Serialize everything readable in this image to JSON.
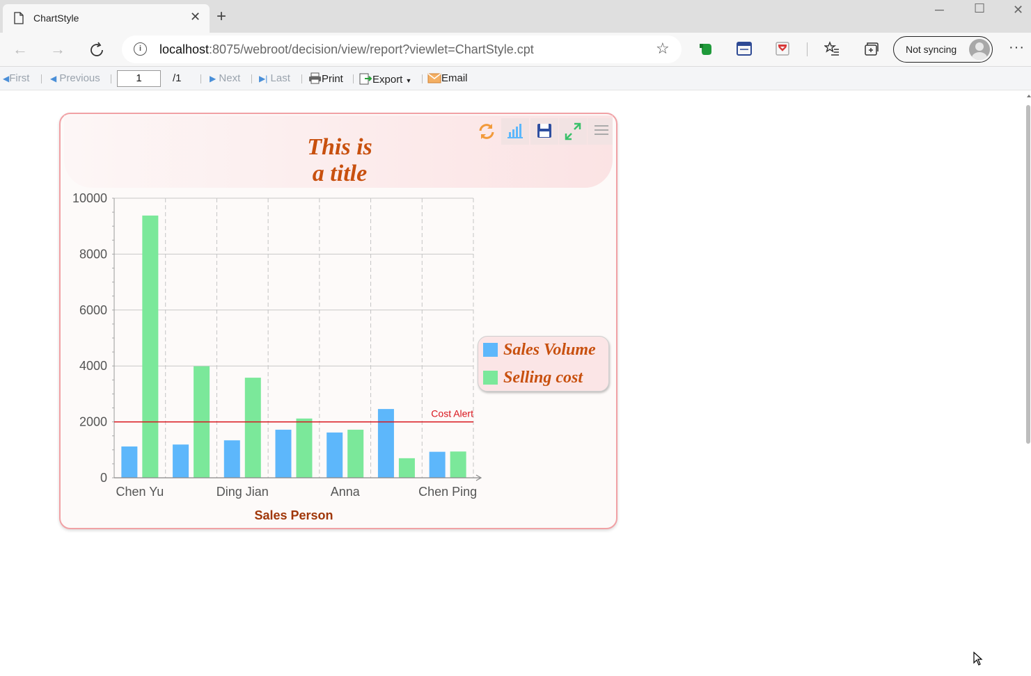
{
  "browser": {
    "tab_title": "ChartStyle",
    "url_host": "localhost",
    "url_rest": ":8075/webroot/decision/view/report?viewlet=ChartStyle.cpt",
    "sync_label": "Not syncing"
  },
  "report_toolbar": {
    "first": "First",
    "previous": "Previous",
    "page_value": "1",
    "page_total": "/1",
    "next": "Next",
    "last": "Last",
    "print": "Print",
    "export": "Export",
    "email": "Email"
  },
  "chart_data": {
    "type": "bar",
    "title_line1": "This is",
    "title_line2": "a title",
    "xlabel": "Sales Person",
    "ylabel": "",
    "ylim": [
      0,
      10000
    ],
    "yticks": [
      0,
      2000,
      4000,
      6000,
      8000,
      10000
    ],
    "categories": [
      "Chen Yu",
      "",
      "Ding Jian",
      "",
      "Anna",
      "",
      "Chen Ping"
    ],
    "series": [
      {
        "name": "Sales Volume",
        "color": "#5db7fb",
        "values": [
          1120,
          1190,
          1340,
          1720,
          1620,
          2460,
          930
        ]
      },
      {
        "name": "Selling cost",
        "color": "#7be89a",
        "values": [
          9380,
          3990,
          3580,
          2120,
          1720,
          700,
          940
        ]
      }
    ],
    "reference_line": {
      "label": "Cost Alert",
      "value": 2000,
      "color": "#d9141c"
    },
    "grid": true,
    "legend_position": "right"
  },
  "colors": {
    "panel_border": "#f1a1a5",
    "title_color": "#c8500e",
    "axis_title_color": "#a0370a"
  }
}
